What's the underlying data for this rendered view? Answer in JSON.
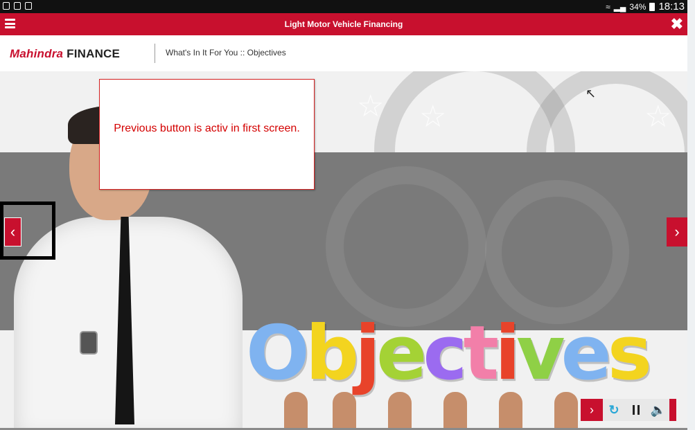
{
  "status_bar": {
    "battery": "34%",
    "time": "18:13"
  },
  "topbar": {
    "title": "Light Motor Vehicle Financing"
  },
  "header": {
    "logo_brand": "Mahindra",
    "logo_suffix": "FINANCE",
    "breadcrumb": "What's In It For You :: Objectives"
  },
  "slide": {
    "word": [
      "O",
      "b",
      "j",
      "e",
      "c",
      "t",
      "i",
      "v",
      "e",
      "s"
    ],
    "word_colors": [
      "#7fb3f0",
      "#f3d41f",
      "#e8432a",
      "#a4d235",
      "#9b6bf0",
      "#f27fa9",
      "#e8432a",
      "#8fd046",
      "#7fb3f0",
      "#f3d41f"
    ]
  },
  "annotation": {
    "text": "Previous button is activ in first screen."
  },
  "icons": {
    "menu": "hamburger-icon",
    "close": "close-icon",
    "prev": "chevron-left-icon",
    "next": "chevron-right-icon",
    "replay": "replay-icon",
    "pause": "pause-icon",
    "audio": "speaker-icon"
  },
  "colors": {
    "brand_red": "#c8102e",
    "annotation_red": "#d40000"
  }
}
